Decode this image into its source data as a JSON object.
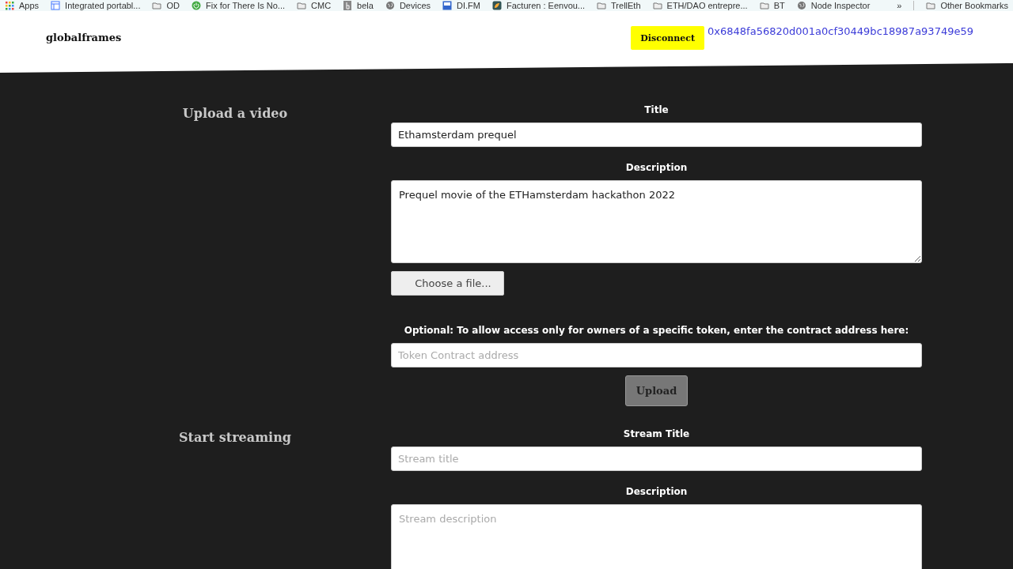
{
  "bookmarks": [
    {
      "kind": "apps",
      "label": "Apps"
    },
    {
      "kind": "page",
      "label": "Integrated portabl..."
    },
    {
      "kind": "folder",
      "label": "OD"
    },
    {
      "kind": "power",
      "label": "Fix for There Is No..."
    },
    {
      "kind": "folder",
      "label": "CMC"
    },
    {
      "kind": "letter",
      "label": "bela"
    },
    {
      "kind": "globe",
      "label": "Devices"
    },
    {
      "kind": "tile",
      "label": "DI.FM"
    },
    {
      "kind": "leaf",
      "label": "Facturen : Eenvou..."
    },
    {
      "kind": "folder",
      "label": "TrellEth"
    },
    {
      "kind": "folder",
      "label": "ETH/DAO entrepre..."
    },
    {
      "kind": "folder",
      "label": "BT"
    },
    {
      "kind": "globe",
      "label": "Node Inspector"
    }
  ],
  "bookmarks_more": "»",
  "other_bookmarks": "Other Bookmarks",
  "header": {
    "brand": "globalframes",
    "disconnect": "Disconnect",
    "address": "0x6848fa56820d001a0cf30449bc18987a93749e59"
  },
  "sections": [
    {
      "title": "Upload a video",
      "fields": [
        {
          "kind": "input",
          "label": "Title",
          "value": "Ethamsterdam prequel"
        },
        {
          "kind": "textarea",
          "label": "Description",
          "value": "Prequel movie of the ETHamsterdam hackathon 2022"
        },
        {
          "kind": "file",
          "button": "Choose a file..."
        },
        {
          "kind": "input",
          "label": "Optional: To allow access only for owners of a specific token, enter the contract address here:",
          "placeholder": "Token Contract address"
        },
        {
          "kind": "submit",
          "button": "Upload"
        }
      ]
    },
    {
      "title": "Start streaming",
      "fields": [
        {
          "kind": "input",
          "label": "Stream Title",
          "placeholder": "Stream title"
        },
        {
          "kind": "textarea",
          "label": "Description",
          "placeholder": "Stream description"
        }
      ]
    }
  ]
}
